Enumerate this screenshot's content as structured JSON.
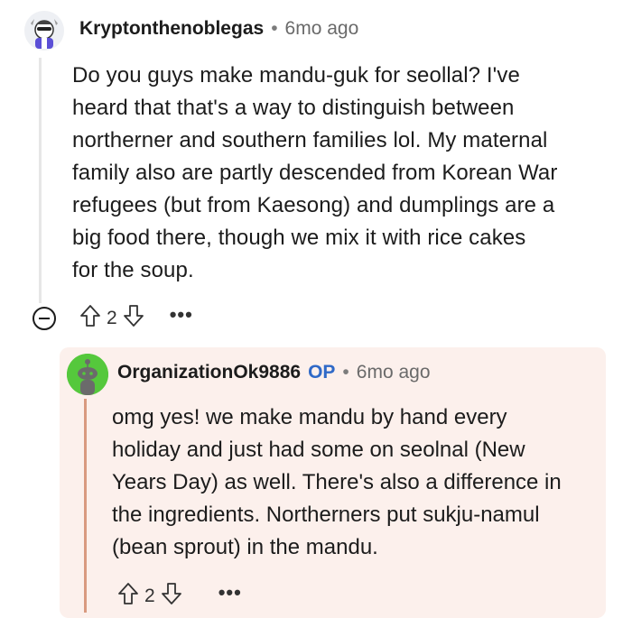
{
  "comment": {
    "username": "Kryptonthenoblegas",
    "separator": "•",
    "time": "6mo ago",
    "body": "Do you guys make mandu-guk for seollal? I've\nheard that that's a way to distinguish between\nnortherner and southern families lol. My maternal\nfamily also are partly descended from Korean War\nrefugees (but from Kaesong) and dumplings are a\nbig food there, though we mix it with rice cakes\nfor the soup.",
    "votes": "2",
    "more": "•••"
  },
  "reply": {
    "username": "OrganizationOk9886",
    "badge": "OP",
    "separator": "•",
    "time": "6mo ago",
    "body": "omg yes! we make mandu by hand every\nholiday and just had some on seolnal (New\nYears Day) as well. There's also a difference in\nthe ingredients. Northerners put sukju-namul\n(bean sprout) in the mandu.",
    "votes": "2",
    "more": "•••"
  },
  "colors": {
    "reply_background": "#fcf0ec",
    "op_badge": "#2f69c7",
    "reply_thread_line": "#d99a80",
    "avatar_green": "#55c83c"
  },
  "icons": [
    "collapse-icon",
    "upvote-icon",
    "downvote-icon",
    "more-options-icon",
    "user-avatar-icon",
    "snoo-avatar-icon"
  ]
}
